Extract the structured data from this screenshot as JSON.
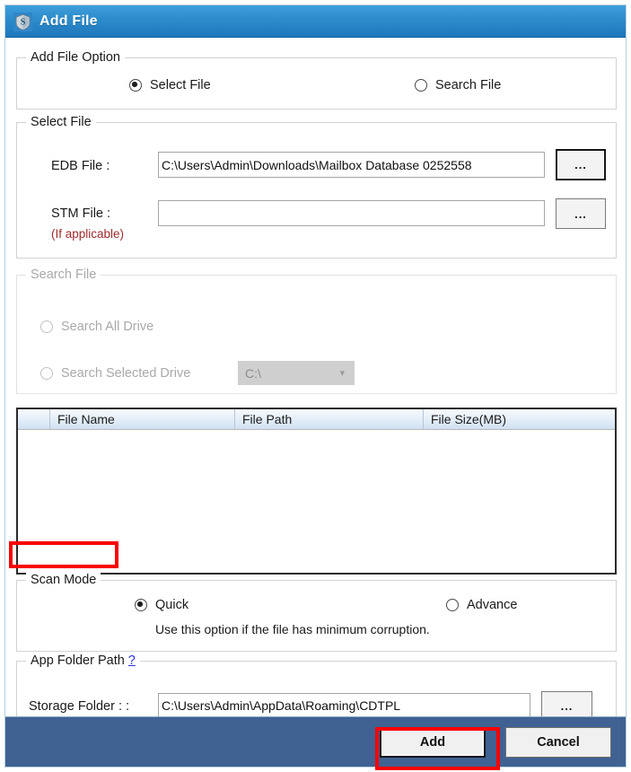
{
  "window": {
    "title": "Add File",
    "icon": "shield-app-icon",
    "titlebar_color_start": "#3f9fdb",
    "titlebar_color_end": "#1d76ba",
    "footer_color": "#3f6293",
    "annotation_color": "#f80000"
  },
  "add_file_option": {
    "legend": "Add File Option",
    "options": [
      {
        "label": "Select File",
        "selected": true
      },
      {
        "label": "Search File",
        "selected": false
      }
    ]
  },
  "select_file": {
    "legend": "Select File",
    "edb": {
      "label": "EDB File :",
      "value": "C:\\Users\\Admin\\Downloads\\Mailbox Database 0252558",
      "placeholder": "",
      "browse_label": "..."
    },
    "stm": {
      "label": "STM File :",
      "sub_label": "(If applicable)",
      "value": "",
      "placeholder": "",
      "browse_label": "..."
    }
  },
  "search_file": {
    "legend": "Search File",
    "disabled": true,
    "options": [
      {
        "label": "Search All Drive",
        "selected": false
      },
      {
        "label": "Search Selected Drive",
        "selected": false
      }
    ],
    "drive_select": {
      "value": "C:\\",
      "chevron": "chevron-down-icon"
    }
  },
  "file_list": {
    "columns": [
      "",
      "File Name",
      "File Path",
      "File Size(MB)"
    ],
    "rows": []
  },
  "scan_mode": {
    "legend": "Scan Mode",
    "highlighted": true,
    "options": [
      {
        "label": "Quick",
        "selected": true
      },
      {
        "label": "Advance",
        "selected": false
      }
    ],
    "hint": "Use this option if the file has minimum corruption."
  },
  "app_folder_path": {
    "legend": "App Folder Path",
    "help_label": "?",
    "storage": {
      "label": "Storage Folder :  :",
      "value": "C:\\Users\\Admin\\AppData\\Roaming\\CDTPL",
      "placeholder": "",
      "browse_label": "..."
    }
  },
  "footer": {
    "add_label": "Add",
    "cancel_label": "Cancel",
    "add_highlighted": true
  }
}
